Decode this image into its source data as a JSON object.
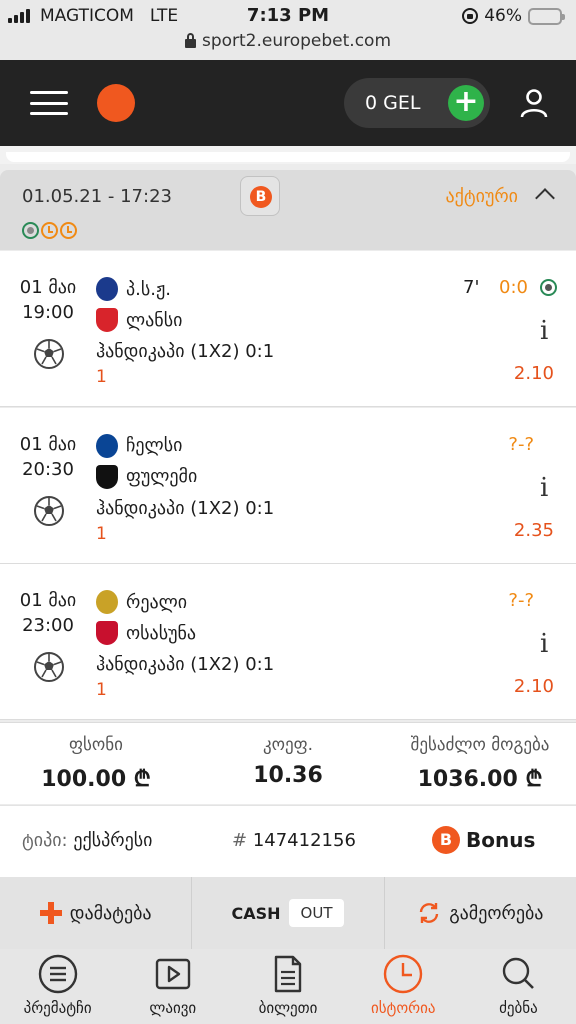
{
  "status_bar": {
    "carrier": "MAGTICOM",
    "network": "LTE",
    "time": "7:13 PM",
    "battery": "46%",
    "battery_level": 0.46,
    "url": "sport2.europebet.com"
  },
  "header": {
    "balance": "0 GEL",
    "add_symbol": "+"
  },
  "ticket": {
    "date": "01.05.21 - 17:23",
    "badge": "B",
    "status": "აქტიური",
    "matches": [
      {
        "date": "01 მაი",
        "time": "19:00",
        "team1": "პ.ს.ჟ.",
        "team2": "ლანსი",
        "market": "ჰანდიკაპი (1X2) 0:1",
        "pick": "1",
        "minute": "7'",
        "score": "0:0",
        "odd": "2.10",
        "team1_color": "#1b3a8c",
        "team2_color": "#d8242b"
      },
      {
        "date": "01 მაი",
        "time": "20:30",
        "team1": "ჩელსი",
        "team2": "ფულემი",
        "market": "ჰანდიკაპი (1X2) 0:1",
        "pick": "1",
        "minute": "",
        "score": "?-?",
        "odd": "2.35",
        "team1_color": "#0a4595",
        "team2_color": "#111111"
      },
      {
        "date": "01 მაი",
        "time": "23:00",
        "team1": "რეალი",
        "team2": "ოსასუნა",
        "market": "ჰანდიკაპი (1X2) 0:1",
        "pick": "1",
        "minute": "",
        "score": "?-?",
        "odd": "2.10",
        "team1_color": "#c9a227",
        "team2_color": "#c8102e"
      }
    ],
    "summary": {
      "stake_label": "ფსონი",
      "stake_value": "100.00 ₾",
      "odds_label": "კოეფ.",
      "odds_value": "10.36",
      "win_label": "შესაძლო მოგება",
      "win_value": "1036.00 ₾"
    },
    "type_label": "ტიპი:",
    "type_value": "ექსპრესი",
    "number_label": "#",
    "number_value": "147412156",
    "bonus_badge": "B",
    "bonus_label": "Bonus"
  },
  "actions": {
    "add": "დამატება",
    "cash": "CASH",
    "out": "OUT",
    "repeat": "გამეორება"
  },
  "tabs": [
    {
      "label": "პრემატჩი",
      "icon": "list-icon"
    },
    {
      "label": "ლაივი",
      "icon": "play-icon"
    },
    {
      "label": "ბილეთი",
      "icon": "document-icon"
    },
    {
      "label": "ისტორია",
      "icon": "clock-icon",
      "active": true
    },
    {
      "label": "ძებნა",
      "icon": "search-icon"
    }
  ],
  "colors": {
    "brand": "#f0581f",
    "accent_orange": "#f08a14",
    "live_green": "#2a8a57",
    "add_green": "#2fb34a"
  }
}
